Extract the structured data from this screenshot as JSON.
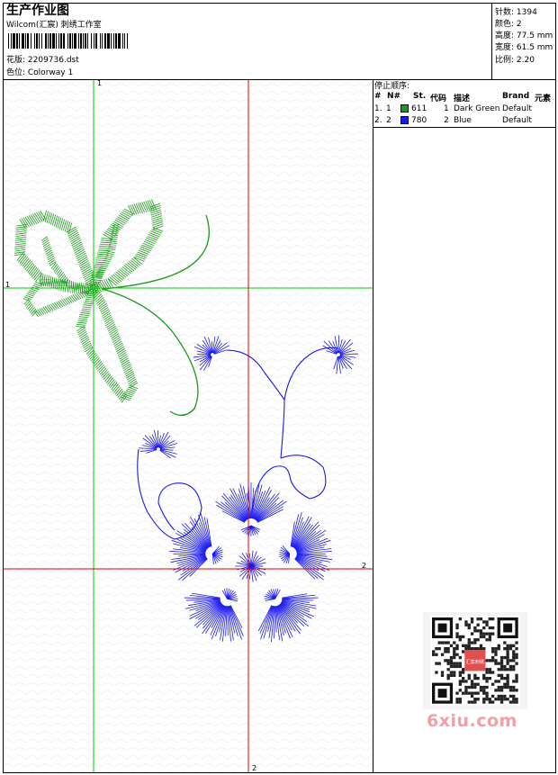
{
  "header": {
    "title": "生产作业图",
    "subtitle": "Wilcom(汇宸) 刺绣工作室",
    "design_label": "花版: 2209736.dst",
    "color_label": "色位: Colorway 1"
  },
  "stats": {
    "stitches": "针数: 1394",
    "colors": "颜色: 2",
    "height": "高度: 77.5 mm",
    "width": "宽度: 61.5 mm",
    "scale": "比例: 2.20"
  },
  "stop_sequence": {
    "title": "停止顺序:",
    "columns": [
      "#",
      "N#",
      "St.",
      "代码",
      "描述",
      "Brand",
      "元素"
    ],
    "rows": [
      {
        "index": "1.",
        "n": "1",
        "color": "#1a9a1a",
        "st": "611",
        "code": "1",
        "desc": "Dark Green",
        "brand": "Default"
      },
      {
        "index": "2.",
        "n": "2",
        "color": "#1a1aee",
        "st": "780",
        "code": "2",
        "desc": "Blue",
        "brand": "Default"
      }
    ]
  },
  "canvas": {
    "marker_top_green": "1",
    "marker_left_green": "1",
    "marker_right_red": "2",
    "marker_bottom_red": "2",
    "green_color": "#00cc00",
    "red_color": "#dd0000",
    "green_thread": "#1a9a1a",
    "blue_thread": "#1a1aee"
  },
  "watermark": "6xiu.com",
  "qr_badge": "汇宸刺绣"
}
